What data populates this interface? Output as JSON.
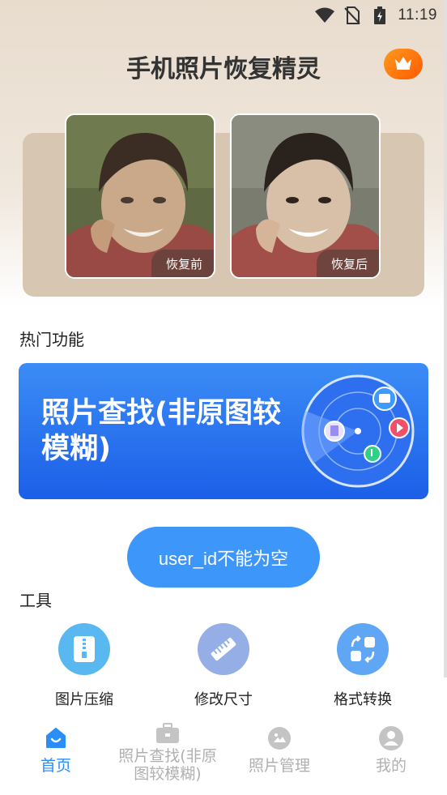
{
  "status_bar": {
    "time": "11:19",
    "icons": [
      "wifi-icon",
      "no-sim-icon",
      "battery-charging-icon"
    ]
  },
  "header": {
    "title": "手机照片恢复精灵",
    "vip_icon": "crown-icon"
  },
  "compare": {
    "before_label": "恢复前",
    "after_label": "恢复后"
  },
  "hot": {
    "section_title": "热门功能",
    "banner_title": "照片查找(非原图较模糊)"
  },
  "toast": {
    "message": "user_id不能为空"
  },
  "tools": {
    "section_title": "工具",
    "items": [
      {
        "label": "图片压缩",
        "icon": "zip-icon",
        "color": "#5ab8f0"
      },
      {
        "label": "修改尺寸",
        "icon": "ruler-icon",
        "color": "#96aee6"
      },
      {
        "label": "格式转换",
        "icon": "convert-icon",
        "color": "#5fa6f4"
      }
    ]
  },
  "nav": {
    "items": [
      {
        "label": "首页",
        "icon": "home-icon",
        "active": true
      },
      {
        "label": "照片查找(非原图较模糊)",
        "icon": "toolbox-icon",
        "active": false
      },
      {
        "label": "照片管理",
        "icon": "image-icon",
        "active": false
      },
      {
        "label": "我的",
        "icon": "user-icon",
        "active": false
      }
    ],
    "active_color": "#2b8ef8",
    "inactive_color": "#b0b0b0"
  }
}
